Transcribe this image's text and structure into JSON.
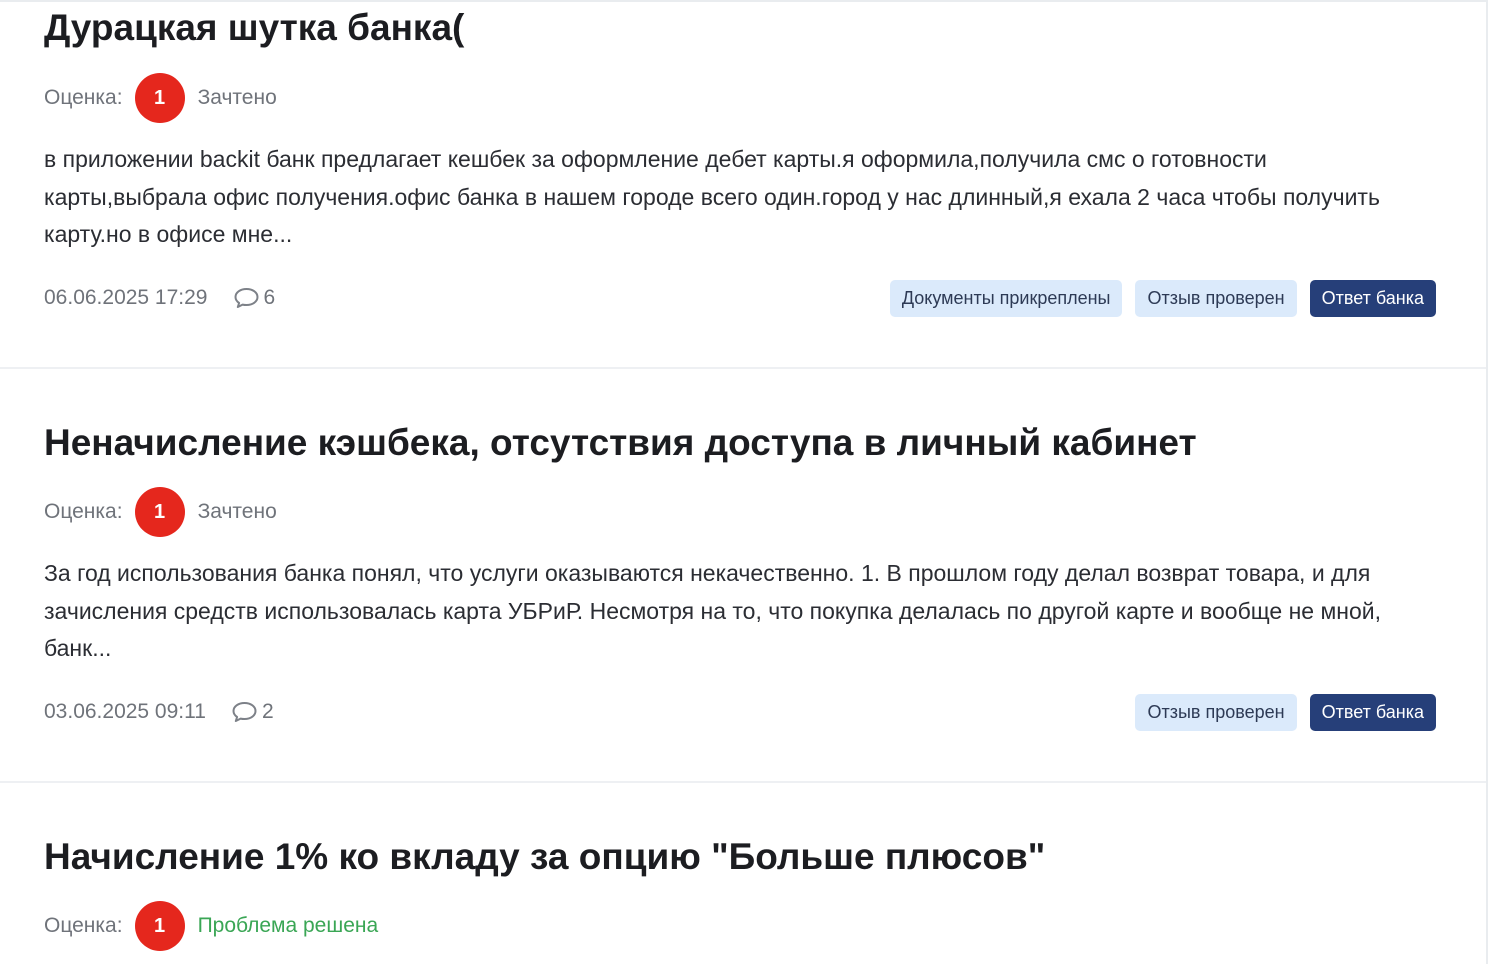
{
  "reviews": [
    {
      "title": "Дурацкая шутка банка(",
      "rating_label": "Оценка:",
      "score": "1",
      "status": "Зачтено",
      "body": "в приложении backit банк предлагает кешбек за оформление дебет карты.я оформила,получила смс о готовности карты,выбрала офис получения.офис банка в нашем городе всего один.город у нас длинный,я ехала 2 часа чтобы получить карту.но в офисе мне...",
      "date": "06.06.2025 17:29",
      "comments": "6",
      "tags": [
        "Документы прикреплены",
        "Отзыв проверен",
        "Ответ банка"
      ]
    },
    {
      "title": "Неначисление кэшбека, отсутствия доступа в личный кабинет",
      "rating_label": "Оценка:",
      "score": "1",
      "status": "Зачтено",
      "body": "За год использования банка понял, что услуги оказываются некачественно. 1. В прошлом году делал возврат товара, и для зачисления средств использовалась карта УБРиР. Несмотря на то, что покупка делалась по другой карте и вообще не мной, банк...",
      "date": "03.06.2025 09:11",
      "comments": "2",
      "tags": [
        "Отзыв проверен",
        "Ответ банка"
      ]
    },
    {
      "title": "Начисление 1% ко вкладу за опцию \"Больше плюсов\"",
      "rating_label": "Оценка:",
      "score": "1",
      "status": "Проблема решена"
    }
  ],
  "colors": {
    "score_badge": "#e5271d",
    "status_solved": "#3aa655",
    "tag_light_bg": "#dbeafb",
    "tag_dark_bg": "#263f79"
  },
  "icons": {
    "comments": "speech-bubble-icon"
  }
}
